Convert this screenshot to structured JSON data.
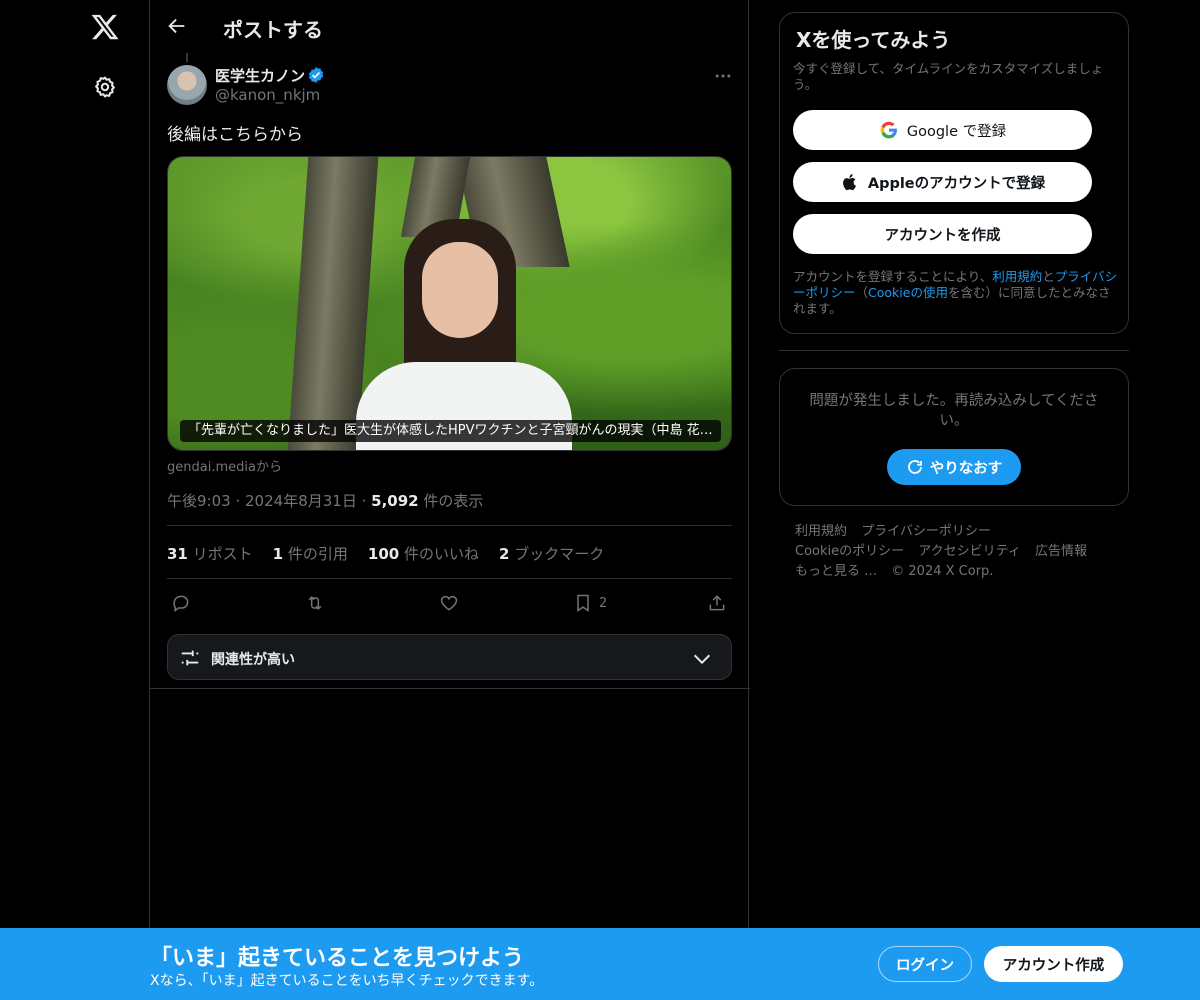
{
  "header": {
    "title": "ポストする"
  },
  "post": {
    "author_name": "医学生カノン",
    "handle": "@kanon_nkjm",
    "text": "後編はこちらから",
    "card_caption": "「先輩が亡くなりました」医大生が体感したHPVワクチンと子宮頸がんの現実（中島 花…",
    "card_source": "gendai.mediaから",
    "time": "午後9:03",
    "date": "2024年8月31日",
    "views_count": "5,092",
    "views_label": "件の表示",
    "stats": {
      "reposts_count": "31",
      "reposts_label": "リポスト",
      "quotes_count": "1",
      "quotes_label": "件の引用",
      "likes_count": "100",
      "likes_label": "件のいいね",
      "bookmarks_count": "2",
      "bookmarks_label": "ブックマーク"
    },
    "actions": {
      "bookmark_count": "2"
    },
    "relevance_label": "関連性が高い"
  },
  "signup": {
    "title": "Xを使ってみよう",
    "description": "今すぐ登録して、タイムラインをカスタマイズしましょう。",
    "google_label": "Google で登録",
    "apple_label": "Appleのアカウントで登録",
    "create_label": "アカウントを作成",
    "terms_prefix": "アカウントを登録することにより、",
    "terms_link": "利用規約",
    "terms_and": "と",
    "privacy_link": "プライバシーポリシー",
    "terms_paren_open": "（",
    "cookie_link": "Cookieの使用",
    "terms_suffix": "を含む）に同意したとみなされます。"
  },
  "error": {
    "message": "問題が発生しました。再読み込みしてください。",
    "retry_label": "やりなおす"
  },
  "footer": {
    "links": [
      "利用規約",
      "プライバシーポリシー",
      "Cookieのポリシー",
      "アクセシビリティ",
      "広告情報",
      "もっと見る …",
      "© 2024 X Corp."
    ]
  },
  "banner": {
    "title": "「いま」起きていることを見つけよう",
    "subtitle": "Xなら、「いま」起きていることをいち早くチェックできます。",
    "login_label": "ログイン",
    "create_label": "アカウント作成"
  },
  "colors": {
    "accent": "#1d9bf0",
    "background": "#000000",
    "border": "#2f3336",
    "muted": "#71767b"
  }
}
